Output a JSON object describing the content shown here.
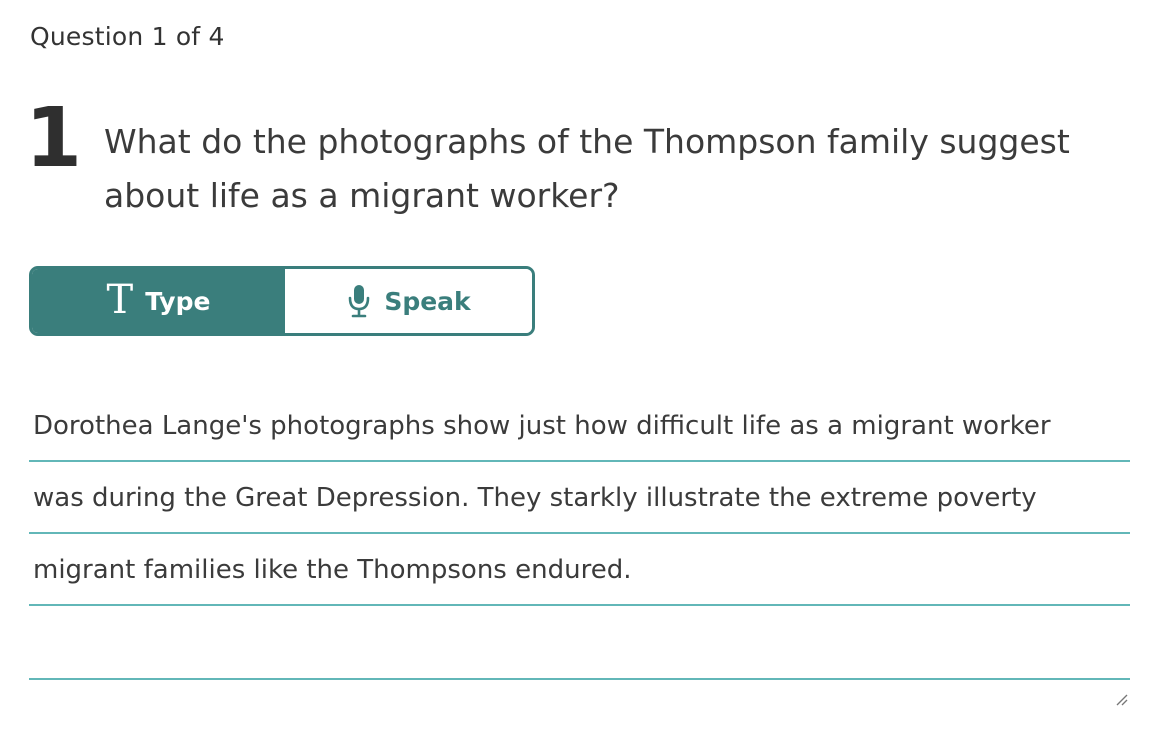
{
  "header": {
    "progress": "Question 1 of 4"
  },
  "question": {
    "number": "1",
    "text": "What do the photographs of the Thompson family suggest about life as a migrant worker?"
  },
  "mode_toggle": {
    "type_label": "Type",
    "speak_label": "Speak",
    "type_icon": "text-t-icon",
    "speak_icon": "microphone-icon",
    "selected": "Type"
  },
  "answer": {
    "lines": [
      "Dorothea Lange's photographs show just how difficult life as a migrant worker",
      "was during the Great Depression. They starkly illustrate the extreme poverty",
      "migrant families like the Thompsons endured."
    ]
  },
  "colors": {
    "accent": "#3a7e7c",
    "rule_line": "#62b7b8",
    "text": "#3b3b3b"
  }
}
